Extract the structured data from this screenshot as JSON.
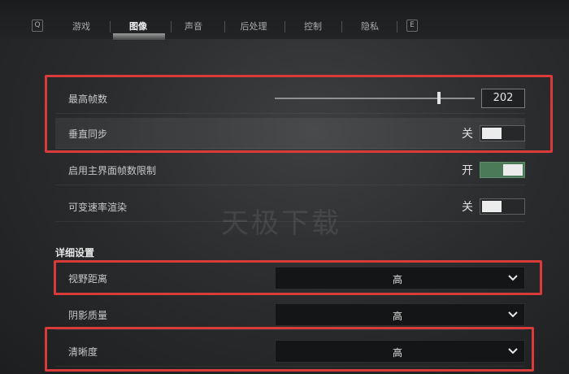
{
  "tabs": {
    "left_key": "Q",
    "right_key": "E",
    "items": [
      {
        "label": "游戏"
      },
      {
        "label": "图像"
      },
      {
        "label": "声音"
      },
      {
        "label": "后处理"
      },
      {
        "label": "控制"
      },
      {
        "label": "隐私"
      }
    ],
    "active": "图像"
  },
  "settings": {
    "max_fps": {
      "label": "最高帧数",
      "value": "202",
      "slider_fraction": 0.82
    },
    "vsync": {
      "label": "垂直同步",
      "state": "关"
    },
    "menu_fps_limit": {
      "label": "启用主界面帧数限制",
      "state": "开"
    },
    "vrs": {
      "label": "可变速率渲染",
      "state": "关"
    }
  },
  "details": {
    "title": "详细设置",
    "view_distance": {
      "label": "视野距离",
      "value": "高"
    },
    "shadow_quality": {
      "label": "阴影质量",
      "value": "高"
    },
    "clarity": {
      "label": "清晰度",
      "value": "高"
    }
  },
  "watermark": "天极下载",
  "colors": {
    "toggle_on": "#4a7a57",
    "highlight": "#d93a3a"
  }
}
